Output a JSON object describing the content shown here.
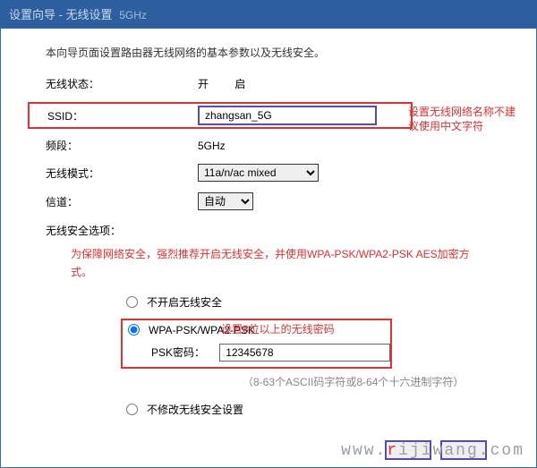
{
  "titlebar": {
    "main": "设置向导 - 无线设置",
    "sub": "5GHz"
  },
  "description": "本向导页面设置路由器无线网络的基本参数以及无线安全。",
  "fields": {
    "wireless_status_label": "无线状态：",
    "wireless_status_value": "开 启",
    "ssid_label": "SSID：",
    "ssid_value": "zhangsan_5G",
    "band_label": "频段：",
    "band_value": "5GHz",
    "mode_label": "无线模式：",
    "mode_value": "11a/n/ac mixed",
    "channel_label": "信道：",
    "channel_value": "自动"
  },
  "security": {
    "section_label": "无线安全选项：",
    "warning": "为保障网络安全，强烈推荐开启无线安全，并使用WPA-PSK/WPA2-PSK AES加密方式。",
    "option_none": "不开启无线安全",
    "option_wpa": "WPA-PSK/WPA2-PSK",
    "psk_label": "PSK密码：",
    "psk_value": "12345678",
    "psk_hint": "（8-63个ASCII码字符或8-64个十六进制字符）",
    "option_keep": "不修改无线安全设置"
  },
  "notes": {
    "ssid_note": "设置无线网络名称不建议使用中文字符",
    "pwd_note": "设置8位以上的无线密码"
  },
  "buttons": {
    "back": "",
    "next": ""
  },
  "watermark": {
    "w": "www.",
    "r": "r",
    "rest": "ijiwang.com"
  }
}
